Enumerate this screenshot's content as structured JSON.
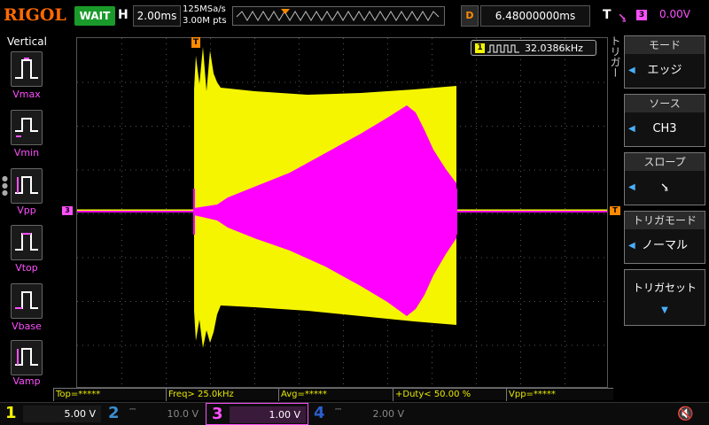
{
  "header": {
    "logo": "RIGOL",
    "status": "WAIT",
    "horizontal_letter": "H",
    "timebase": "2.00ms",
    "sample_rate": "125MSa/s",
    "memory_depth": "3.00M pts",
    "delay_letter": "D",
    "delay": "6.48000000ms",
    "trigger_letter": "T",
    "trigger_source_badge": "3",
    "trigger_level": "0.00V"
  },
  "left_panel": {
    "title": "Vertical",
    "items": [
      {
        "label": "Vmax",
        "icon": "vmax-icon"
      },
      {
        "label": "Vmin",
        "icon": "vmin-icon"
      },
      {
        "label": "Vpp",
        "icon": "vpp-icon"
      },
      {
        "label": "Vtop",
        "icon": "vtop-icon"
      },
      {
        "label": "Vbase",
        "icon": "vbase-icon"
      },
      {
        "label": "Vamp",
        "icon": "vamp-icon"
      }
    ]
  },
  "screen": {
    "frequency_counter_channel": "1",
    "frequency_counter": "32.0386kHz",
    "trigger_marker": "T",
    "ch3_marker": "3",
    "trigger_level_marker": "T"
  },
  "right_panel": {
    "side_title": "トリガー",
    "menus": [
      {
        "title": "モード",
        "value": "エッジ"
      },
      {
        "title": "ソース",
        "value": "CH3"
      },
      {
        "title": "スロープ",
        "value": "⭸"
      },
      {
        "title": "トリガモード",
        "value": "ノーマル"
      },
      {
        "title": "トリガセット",
        "value": "▼"
      }
    ]
  },
  "measurements": [
    {
      "label": "Top=*****"
    },
    {
      "label": "Freq> 25.0kHz"
    },
    {
      "label": "Avg=*****"
    },
    {
      "label": "+Duty< 50.00 %"
    },
    {
      "label": "Vpp=*****"
    }
  ],
  "channels": [
    {
      "num": "1",
      "scale": "5.00 V",
      "color": "#f5f500",
      "active": true
    },
    {
      "num": "2",
      "scale": "10.0 V",
      "color": "#3a8fd0",
      "active": false
    },
    {
      "num": "3",
      "scale": "1.00 V",
      "color": "#ff4fff",
      "active": true
    },
    {
      "num": "4",
      "scale": "2.00 V",
      "color": "#2a5fd0",
      "active": false
    }
  ],
  "colors": {
    "ch1": "#f5f500",
    "ch3": "#ff00ff",
    "accent": "#ff8a00",
    "status_green": "#1a9a2a"
  }
}
